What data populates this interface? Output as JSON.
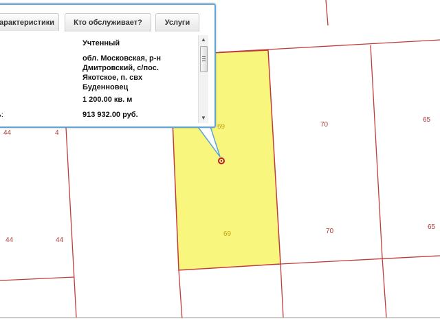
{
  "map": {
    "parcel_labels": [
      "69",
      "69",
      "70",
      "70",
      "65",
      "65",
      "44",
      "44",
      "44",
      "4"
    ],
    "colors": {
      "boundary": "#c23b3b",
      "selected_fill": "#f9f67d",
      "selected_border": "#c23b3b",
      "label": "#b23a3a",
      "label_selected": "#c9a21a",
      "marker": "#c0162c"
    }
  },
  "popup": {
    "tabs": [
      "арактеристики",
      "Кто обслуживает?",
      "Услуги"
    ],
    "status_value": "Учтенный",
    "address_lines": [
      "обл. Московская, р-н",
      "Дмитровский, с/пос.",
      "Якотское, п. свх",
      "Буденновец"
    ],
    "area_value": "1 200.00 кв. м",
    "cost_label": "ь:",
    "cost_value": "913 932.00 руб.",
    "scroll": {
      "up_icon": "▲",
      "down_icon": "▼"
    }
  }
}
